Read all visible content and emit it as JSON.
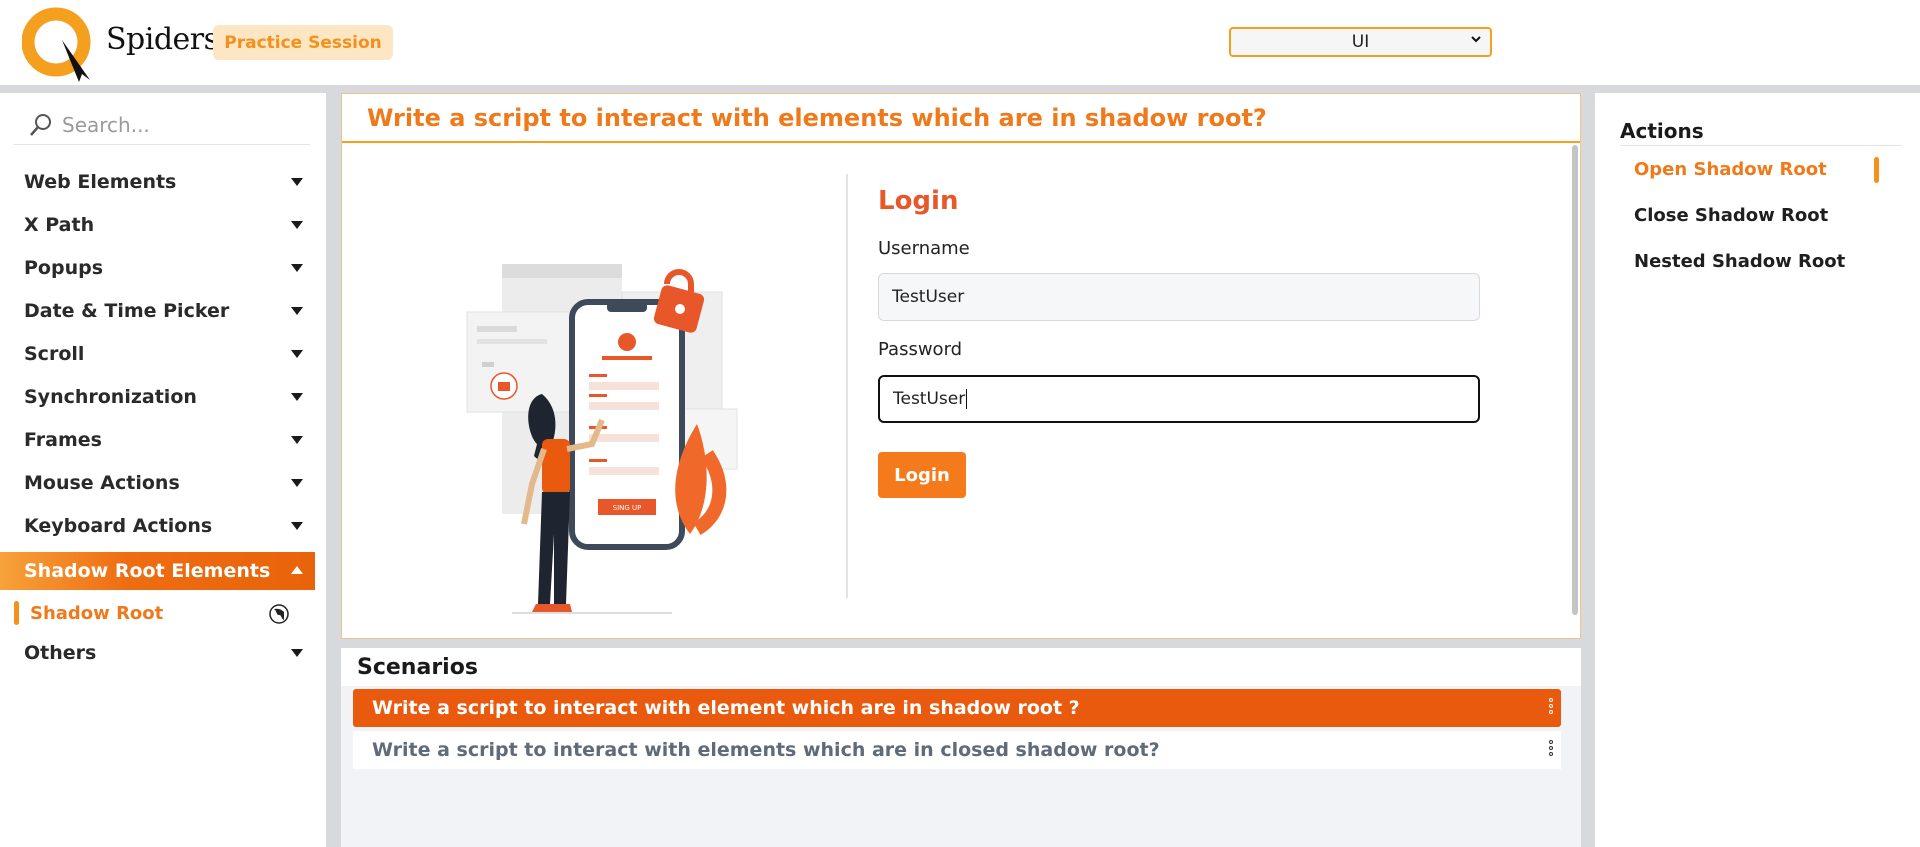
{
  "header": {
    "logo_text": "Spiders",
    "practice_label": "Practice Session",
    "view_select_value": "UI"
  },
  "sidebar": {
    "search_placeholder": "Search...",
    "items": [
      {
        "label": "Web Elements"
      },
      {
        "label": "X Path"
      },
      {
        "label": "Popups"
      },
      {
        "label": "Date & Time Picker"
      },
      {
        "label": "Scroll"
      },
      {
        "label": "Synchronization"
      },
      {
        "label": "Frames"
      },
      {
        "label": "Mouse Actions"
      },
      {
        "label": "Keyboard Actions"
      },
      {
        "label": "Shadow Root Elements"
      },
      {
        "label": "Others"
      }
    ],
    "active_sub_item": "Shadow Root"
  },
  "main": {
    "title": "Write a script to interact with elements which are in shadow root?",
    "login": {
      "title": "Login",
      "username_label": "Username",
      "username_value": "TestUser",
      "password_label": "Password",
      "password_value": "TestUser",
      "button_label": "Login"
    },
    "illustration": {
      "signup_label": "SING UP"
    }
  },
  "scenarios": {
    "title": "Scenarios",
    "items": [
      {
        "label": "Write a script to interact with element which are in shadow root ?",
        "active": true
      },
      {
        "label": "Write a script to interact with elements which are in closed shadow root?",
        "active": false
      }
    ]
  },
  "actions": {
    "title": "Actions",
    "items": [
      {
        "label": "Open Shadow Root",
        "active": true
      },
      {
        "label": "Close Shadow Root",
        "active": false
      },
      {
        "label": "Nested Shadow Root",
        "active": false
      }
    ]
  },
  "colors": {
    "accent": "#ef7a1c",
    "active_bg": "#ea5a0e",
    "login_title": "#e8572a"
  }
}
